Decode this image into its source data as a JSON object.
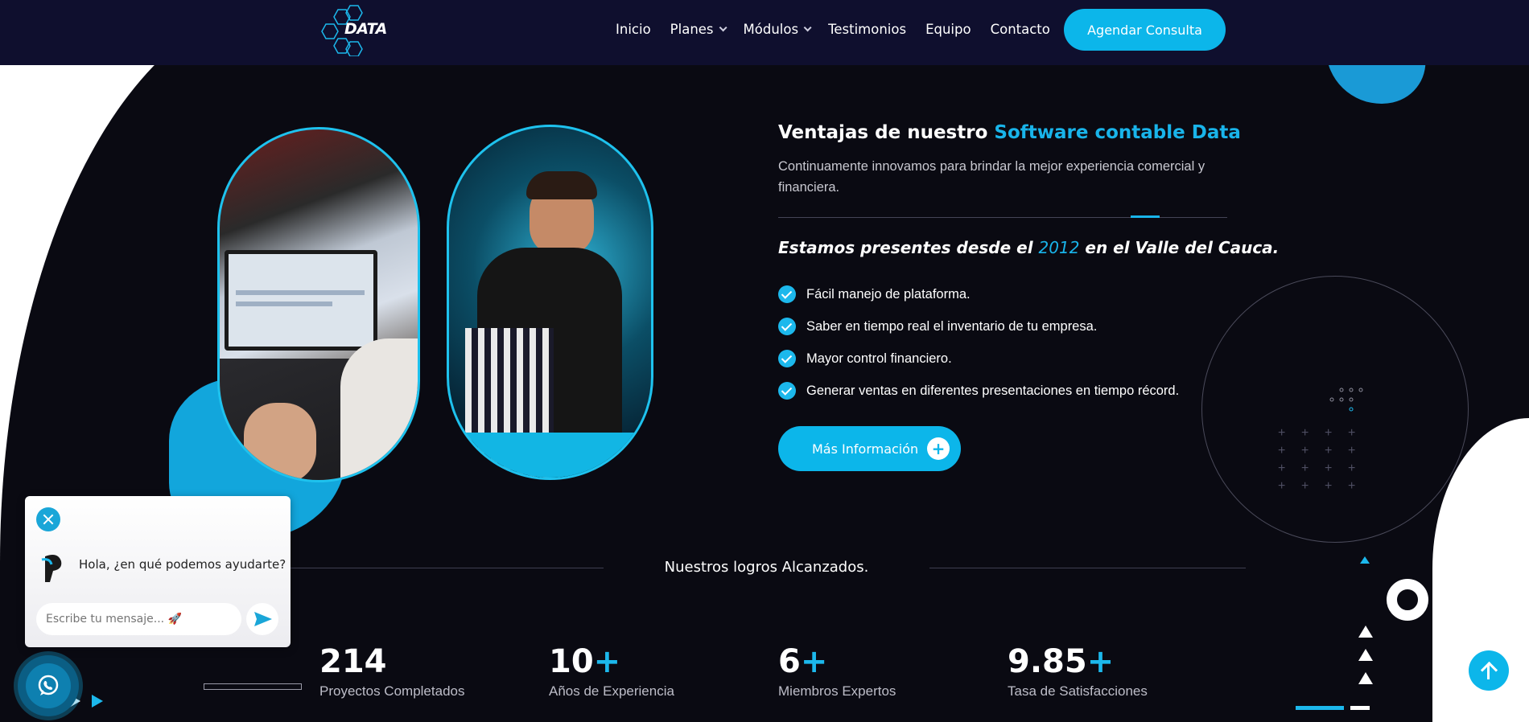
{
  "header": {
    "logo_text": "DATA",
    "nav": [
      {
        "label": "Inicio",
        "dropdown": false
      },
      {
        "label": "Planes",
        "dropdown": true
      },
      {
        "label": "Módulos",
        "dropdown": true
      },
      {
        "label": "Testimonios",
        "dropdown": false
      },
      {
        "label": "Equipo",
        "dropdown": false
      },
      {
        "label": "Contacto",
        "dropdown": false
      }
    ],
    "cta_label": "Agendar Consulta"
  },
  "hero": {
    "title_prefix": "Ventajas de nuestro ",
    "title_accent": "Software contable Data",
    "description": "Continuamente innovamos para brindar la mejor experiencia comercial y financiera.",
    "since_prefix": "Estamos presentes desde el ",
    "since_year": "2012",
    "since_suffix": " en el Valle del Cauca.",
    "features": [
      "Fácil manejo de plataforma.",
      "Saber en tiempo real el inventario de tu empresa.",
      "Mayor control financiero.",
      "Generar ventas en diferentes presentaciones en tiempo récord."
    ],
    "button_label": "Más Información",
    "button_icon": "plus-icon"
  },
  "achievements": {
    "title": "Nuestros logros Alcanzados.",
    "stats": [
      {
        "value": "214",
        "suffix": "",
        "label": "Proyectos Completados"
      },
      {
        "value": "10",
        "suffix": "+",
        "label": "Años de Experiencia"
      },
      {
        "value": "6",
        "suffix": "+",
        "label": "Miembros Expertos"
      },
      {
        "value": "9.85",
        "suffix": "+",
        "label": "Tasa de Satisfacciones"
      }
    ]
  },
  "chat": {
    "greeting": "Hola, ¿en qué podemos ayudarte?",
    "input_placeholder": "Escribe tu mensaje... 🚀",
    "close_icon": "close-icon",
    "send_icon": "send-icon"
  },
  "colors": {
    "accent": "#0cb6ea",
    "header_bg": "#0f0f2e",
    "dark_bg": "#0a0a12"
  }
}
